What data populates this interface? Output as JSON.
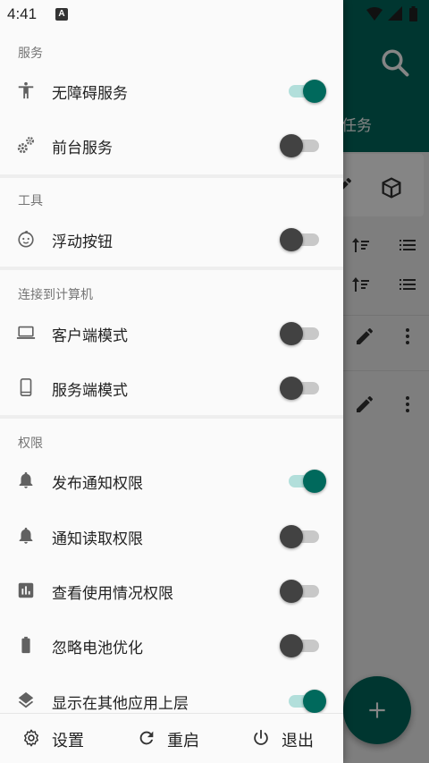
{
  "status_bar": {
    "time": "4:41",
    "notif_letter": "A"
  },
  "background": {
    "tab_label": "任务"
  },
  "drawer": {
    "sections": [
      {
        "header": "服务",
        "items": [
          {
            "label": "无障碍服务",
            "icon": "accessibility-icon",
            "enabled": true
          },
          {
            "label": "前台服务",
            "icon": "gears-icon",
            "enabled": false
          }
        ]
      },
      {
        "header": "工具",
        "items": [
          {
            "label": "浮动按钮",
            "icon": "baby-face-icon",
            "enabled": false
          }
        ]
      },
      {
        "header": "连接到计算机",
        "items": [
          {
            "label": "客户端模式",
            "icon": "laptop-icon",
            "enabled": false
          },
          {
            "label": "服务端模式",
            "icon": "phone-icon",
            "enabled": false
          }
        ]
      },
      {
        "header": "权限",
        "items": [
          {
            "label": "发布通知权限",
            "icon": "bell-icon",
            "enabled": true
          },
          {
            "label": "通知读取权限",
            "icon": "bell-icon",
            "enabled": false
          },
          {
            "label": "查看使用情况权限",
            "icon": "bar-chart-icon",
            "enabled": false
          },
          {
            "label": "忽略电池优化",
            "icon": "battery-icon",
            "enabled": false
          },
          {
            "label": "显示在其他应用上层",
            "icon": "layers-icon",
            "enabled": true
          }
        ]
      }
    ],
    "bottom_bar": {
      "settings": "设置",
      "restart": "重启",
      "exit": "退出"
    }
  },
  "colors": {
    "accent": "#00695c",
    "toolbar": "#00695c",
    "track_on": "#b2dfdb"
  }
}
